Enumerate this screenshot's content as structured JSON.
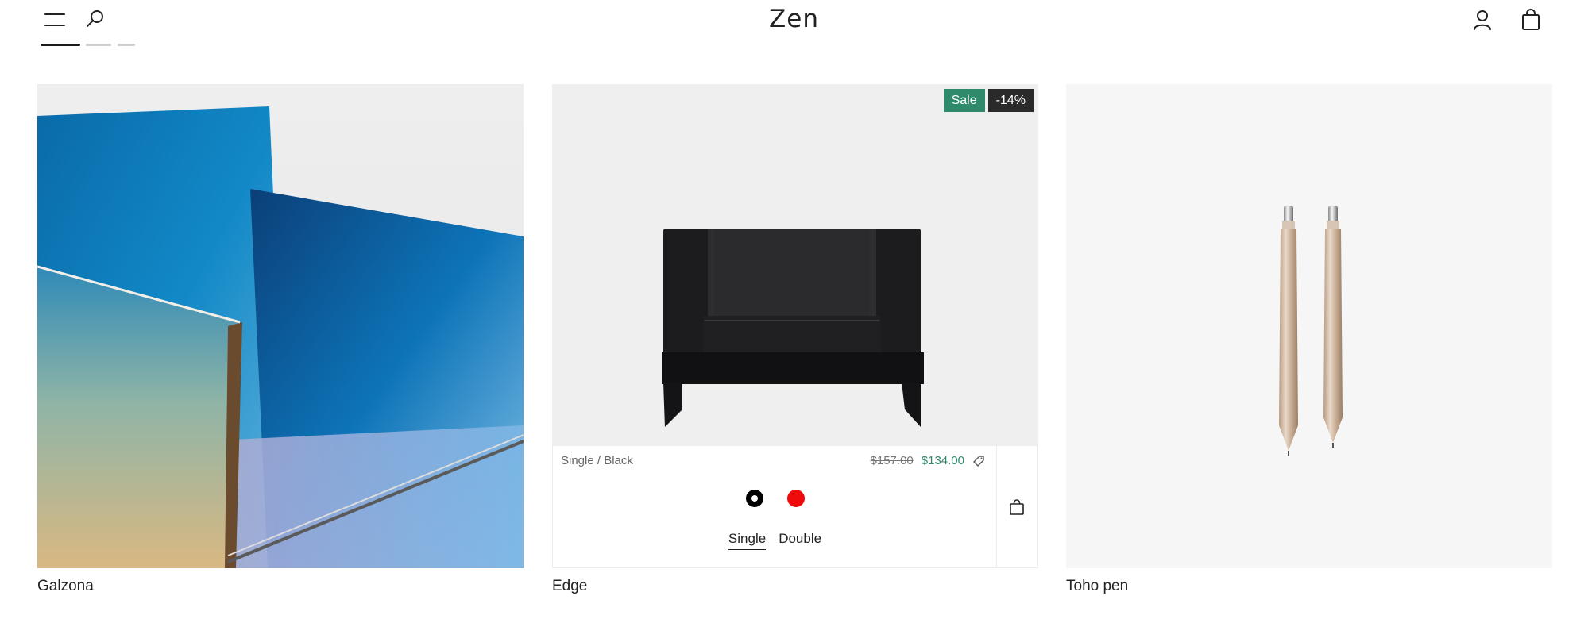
{
  "header": {
    "logo": "Zen",
    "menu_icon": "hamburger-menu-icon",
    "search_icon": "search-icon",
    "account_icon": "user-icon",
    "cart_icon": "shopping-bag-icon"
  },
  "slider": {
    "active_index": 0,
    "count": 3
  },
  "products": [
    {
      "title": "Galzona",
      "image": "glass-table-photo"
    },
    {
      "title": "Edge",
      "image": "black-armchair-photo",
      "badges": {
        "sale": "Sale",
        "discount": "-14%"
      },
      "variant_label": "Single / Black",
      "old_price": "$157.00",
      "new_price": "$134.00",
      "swatches": [
        "Black",
        "Red"
      ],
      "selected_swatch": "Black",
      "sizes": [
        "Single",
        "Double"
      ],
      "selected_size": "Single"
    },
    {
      "title": "Toho pen",
      "image": "gold-pens-photo"
    }
  ],
  "colors": {
    "sale_badge": "#2f8a6c",
    "discount_badge": "#2a2a2a",
    "sale_price": "#2f8a6c",
    "swatch_black": "#000000",
    "swatch_red": "#ef0b0b"
  }
}
